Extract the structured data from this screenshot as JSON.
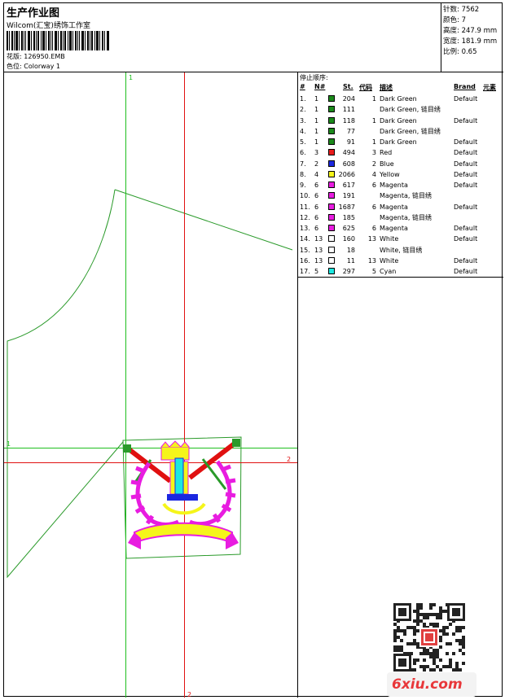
{
  "header": {
    "title": "生产作业图",
    "company": "Wilcom(汇宝)绣饰工作室",
    "design_line": "花版:  126950.EMB",
    "colorway_line": "色位:  Colorway 1"
  },
  "stats": [
    "针数: 7562",
    "颜色: 7",
    "高度: 247.9 mm",
    "宽度: 181.9 mm",
    "比例: 0.65"
  ],
  "stop_sequence": {
    "title": "停止顺序:",
    "columns": {
      "num": "#",
      "n": "N#",
      "st": "St.",
      "code": "代码",
      "desc": "描述",
      "brand": "Brand",
      "elem": "元素"
    },
    "rows": [
      {
        "num": "1.",
        "n": "1",
        "color": "#1b8a1b",
        "st": "204",
        "code": "1",
        "desc": "Dark Green",
        "brand": "Default"
      },
      {
        "num": "2.",
        "n": "1",
        "color": "#1b8a1b",
        "st": "111",
        "code": "",
        "desc": "Dark  Green, 链目绣",
        "brand": ""
      },
      {
        "num": "3.",
        "n": "1",
        "color": "#1b8a1b",
        "st": "118",
        "code": "1",
        "desc": "Dark Green",
        "brand": "Default"
      },
      {
        "num": "4.",
        "n": "1",
        "color": "#1b8a1b",
        "st": "77",
        "code": "",
        "desc": "Dark  Green, 链目绣",
        "brand": ""
      },
      {
        "num": "5.",
        "n": "1",
        "color": "#1b8a1b",
        "st": "91",
        "code": "1",
        "desc": "Dark Green",
        "brand": "Default"
      },
      {
        "num": "6.",
        "n": "3",
        "color": "#e81c1c",
        "st": "494",
        "code": "3",
        "desc": "Red",
        "brand": "Default"
      },
      {
        "num": "7.",
        "n": "2",
        "color": "#1b27e0",
        "st": "608",
        "code": "2",
        "desc": "Blue",
        "brand": "Default"
      },
      {
        "num": "8.",
        "n": "4",
        "color": "#f5f51a",
        "st": "2066",
        "code": "4",
        "desc": "Yellow",
        "brand": "Default"
      },
      {
        "num": "9.",
        "n": "6",
        "color": "#e81ce0",
        "st": "617",
        "code": "6",
        "desc": "Magenta",
        "brand": "Default"
      },
      {
        "num": "10.",
        "n": "6",
        "color": "#e81ce0",
        "st": "191",
        "code": "",
        "desc": "Magenta, 链目绣",
        "brand": ""
      },
      {
        "num": "11.",
        "n": "6",
        "color": "#e81ce0",
        "st": "1687",
        "code": "6",
        "desc": "Magenta",
        "brand": "Default"
      },
      {
        "num": "12.",
        "n": "6",
        "color": "#e81ce0",
        "st": "185",
        "code": "",
        "desc": "Magenta, 链目绣",
        "brand": ""
      },
      {
        "num": "13.",
        "n": "6",
        "color": "#e81ce0",
        "st": "625",
        "code": "6",
        "desc": "Magenta",
        "brand": "Default"
      },
      {
        "num": "14.",
        "n": "13",
        "color": "#ffffff",
        "st": "160",
        "code": "13",
        "desc": "White",
        "brand": "Default"
      },
      {
        "num": "15.",
        "n": "13",
        "color": "#ffffff",
        "st": "18",
        "code": "",
        "desc": "White, 链目绣",
        "brand": ""
      },
      {
        "num": "16.",
        "n": "13",
        "color": "#ffffff",
        "st": "11",
        "code": "13",
        "desc": "White",
        "brand": "Default"
      },
      {
        "num": "17.",
        "n": "5",
        "color": "#1ce8e0",
        "st": "297",
        "code": "5",
        "desc": "Cyan",
        "brand": "Default"
      }
    ]
  },
  "canvas_markers": {
    "green_top": "1",
    "green_left": "1",
    "red_right": "2",
    "red_bottom": "2"
  },
  "watermark": "6xiu.com",
  "colors": {
    "guide_green": "#1fbf1f",
    "guide_red": "#e01010",
    "outline_green": "#2a9a2a"
  }
}
